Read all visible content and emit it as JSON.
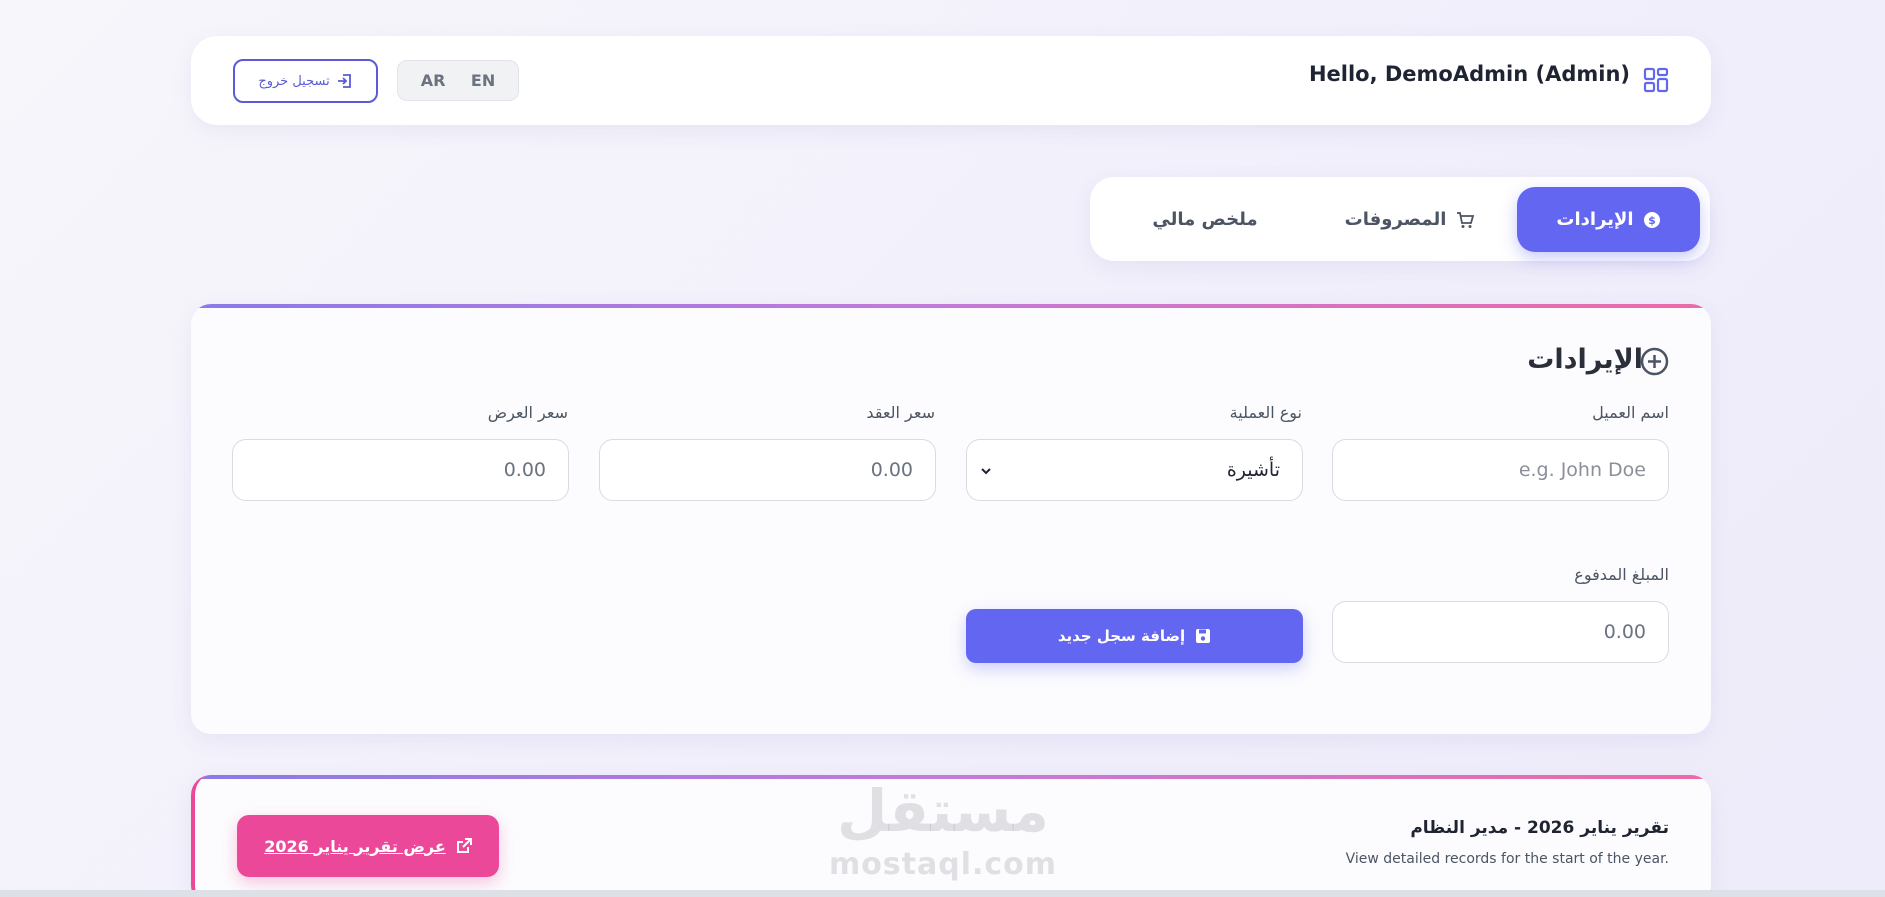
{
  "header": {
    "greeting": "Hello, DemoAdmin (Admin)",
    "logout_label": "تسجيل خروج",
    "languages": [
      "AR",
      "EN"
    ]
  },
  "tabs": [
    {
      "label": "الإيرادات",
      "icon": "dollar-circle-icon",
      "active": true
    },
    {
      "label": "المصروفات",
      "icon": "cart-icon",
      "active": false
    },
    {
      "label": "ملخص مالي",
      "icon": "",
      "active": false
    }
  ],
  "revenue_form": {
    "title": "الإيرادات",
    "fields": {
      "client_name": {
        "label": "اسم العميل",
        "placeholder": "e.g. John Doe"
      },
      "operation_type": {
        "label": "نوع العملية",
        "value": "تأشيرة"
      },
      "contract_price": {
        "label": "سعر العقد",
        "value": "0.00"
      },
      "offer_price": {
        "label": "سعر العرض",
        "value": "0.00"
      },
      "amount_paid": {
        "label": "المبلغ المدفوع",
        "value": "0.00"
      }
    },
    "submit_label": "إضافة سجل جديد"
  },
  "report": {
    "title": "تقرير يناير 2026 - مدير النظام",
    "subtitle": "View detailed records for the start of the year.",
    "button_label": "عرض تقرير يناير 2026"
  },
  "watermark": {
    "ar": "مستقل",
    "en": "mostaql.com"
  },
  "colors": {
    "primary": "#6366f1",
    "accent": "#ec4899",
    "text": "#1f2433"
  }
}
